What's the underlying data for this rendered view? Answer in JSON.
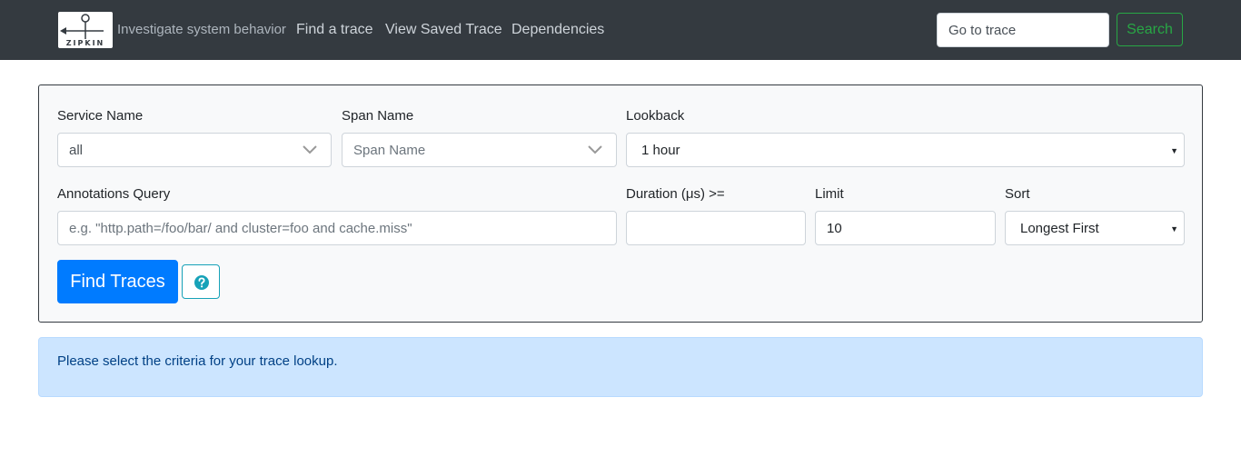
{
  "navbar": {
    "logo_text": "ZIPKIN",
    "tagline": "Investigate system behavior",
    "links": [
      "Find a trace",
      "View Saved Trace",
      "Dependencies"
    ],
    "goto_placeholder": "Go to trace",
    "search_label": "Search",
    "colors": {
      "background": "#343a40",
      "search": "#28a745"
    }
  },
  "form": {
    "service_name": {
      "label": "Service Name",
      "value": "all"
    },
    "span_name": {
      "label": "Span Name",
      "placeholder": "Span Name"
    },
    "lookback": {
      "label": "Lookback",
      "value": "1 hour"
    },
    "annotations": {
      "label": "Annotations Query",
      "placeholder": "e.g. \"http.path=/foo/bar/ and cluster=foo and cache.miss\""
    },
    "duration": {
      "label": "Duration (μs) >=",
      "value": ""
    },
    "limit": {
      "label": "Limit",
      "value": "10"
    },
    "sort": {
      "label": "Sort",
      "value": "Longest First"
    },
    "find_label": "Find Traces",
    "help_icon": "question-circle-icon",
    "colors": {
      "primary": "#007bff",
      "info": "#17a2b8"
    }
  },
  "alert": {
    "text": "Please select the criteria for your trace lookup.",
    "color": "#cce5ff"
  }
}
